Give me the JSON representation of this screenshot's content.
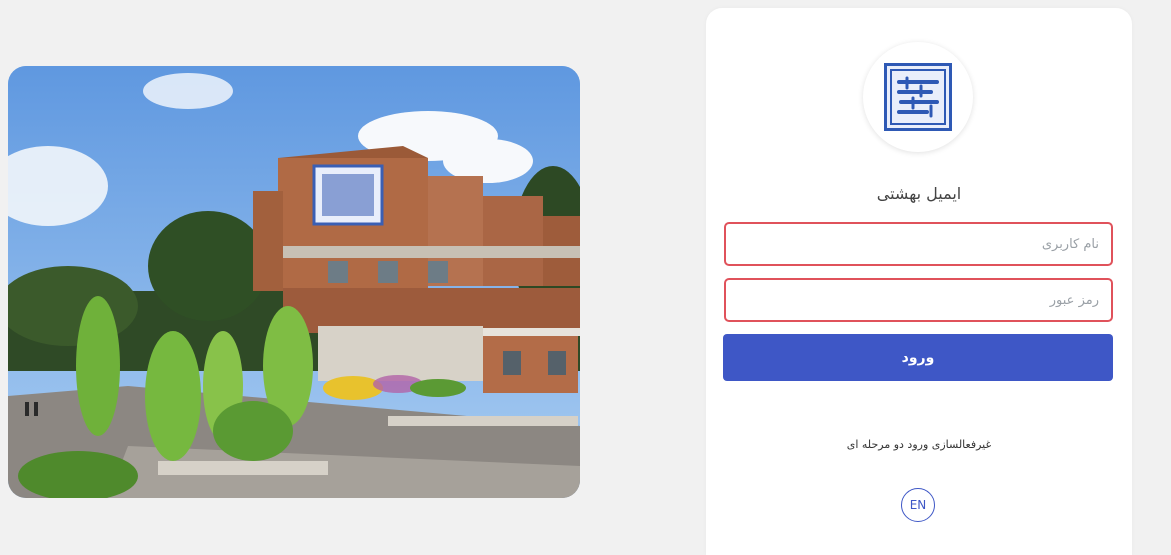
{
  "photo": {
    "alt": "Shahid Beheshti University campus building"
  },
  "login": {
    "logo_icon": "university-logo-icon",
    "title": "ایمیل بهشتی",
    "username_placeholder": "نام کاربری",
    "password_placeholder": "رمز عبور",
    "submit_label": "ورود",
    "twofa_link": "غیرفعالسازی ورود دو مرحله ای",
    "language_button": "EN"
  },
  "colors": {
    "primary": "#3e57c6",
    "field_error_border": "#e0525b",
    "page_bg": "#f1f1f1"
  }
}
